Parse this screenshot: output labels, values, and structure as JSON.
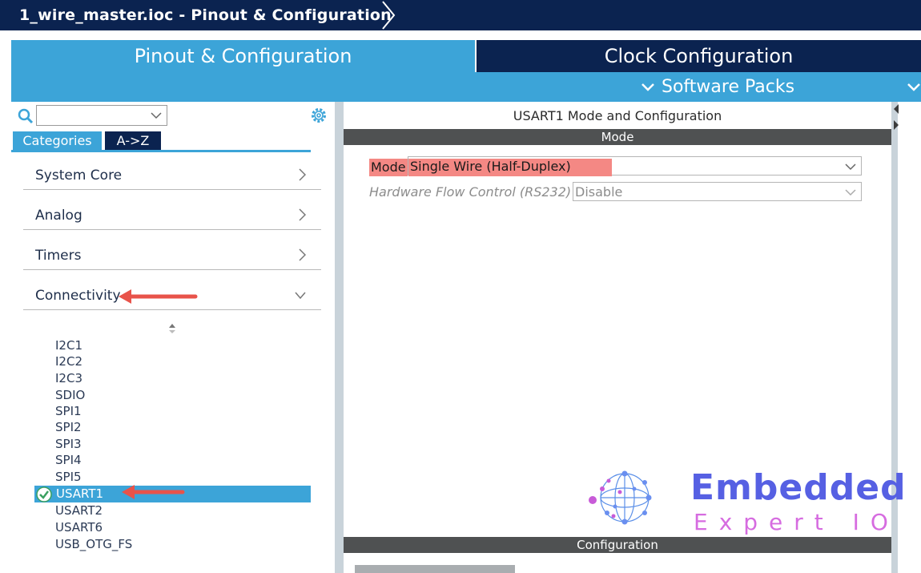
{
  "window": {
    "title": "1_wire_master.ioc - Pinout & Configuration"
  },
  "main_tabs": [
    {
      "label": "Pinout & Configuration",
      "active": true
    },
    {
      "label": "Clock Configuration",
      "active": false
    }
  ],
  "software_packs": {
    "label": "Software Packs"
  },
  "search": {
    "value": "",
    "placeholder": ""
  },
  "view_tabs": [
    {
      "label": "Categories",
      "active": true
    },
    {
      "label": "A->Z",
      "active": false
    }
  ],
  "categories": [
    {
      "label": "System Core",
      "expanded": false
    },
    {
      "label": "Analog",
      "expanded": false
    },
    {
      "label": "Timers",
      "expanded": false
    },
    {
      "label": "Connectivity",
      "expanded": true
    }
  ],
  "peripherals": [
    "I2C1",
    "I2C2",
    "I2C3",
    "SDIO",
    "SPI1",
    "SPI2",
    "SPI3",
    "SPI4",
    "SPI5",
    "USART1",
    "USART2",
    "USART6",
    "USB_OTG_FS"
  ],
  "selected_peripheral": "USART1",
  "config_panel": {
    "title": "USART1 Mode and Configuration",
    "mode_section": "Mode",
    "mode_label": "Mode",
    "mode_value": "Single Wire (Half-Duplex)",
    "hw_flow_label": "Hardware Flow Control (RS232)",
    "hw_flow_value": "Disable",
    "configuration_section": "Configuration"
  },
  "watermark": {
    "title": "Embedded",
    "subtitle": "Expert IO"
  },
  "colors": {
    "navy": "#0b2350",
    "accent_blue": "#3ca4d8",
    "highlight_red": "#f48884",
    "annotation_arrow": "#e8534a",
    "section_bar": "#4f5152"
  }
}
